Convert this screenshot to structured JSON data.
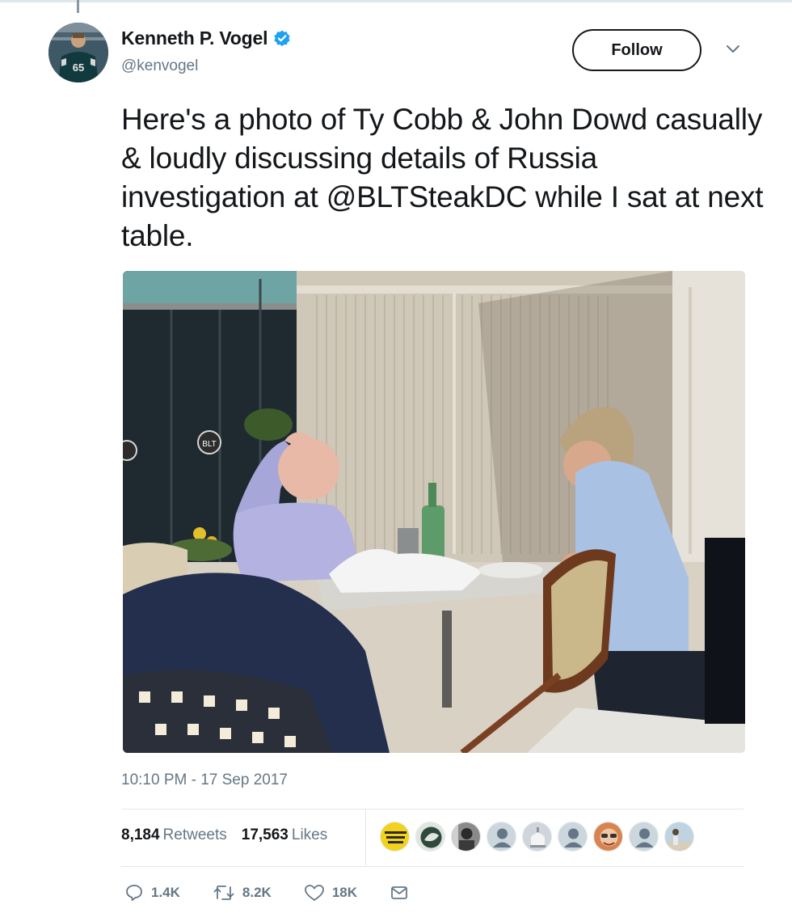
{
  "author": {
    "display_name": "Kenneth P. Vogel",
    "handle": "@kenvogel",
    "verified": true,
    "avatar_jersey_number": "65"
  },
  "follow_button": {
    "label": "Follow"
  },
  "menu": {
    "icon": "chevron-down-icon"
  },
  "tweet": {
    "text": "Here's a photo of Ty Cobb & John Dowd casually & loudly discussing details of Russia investigation at @BLTSteakDC while I sat at next table.",
    "photo": {
      "sign_text": "BLT"
    },
    "timestamp": "10:10 PM - 17 Sep 2017"
  },
  "stats": {
    "retweets": {
      "count": "8,184",
      "label": "Retweets"
    },
    "likes": {
      "count": "17,563",
      "label": "Likes"
    }
  },
  "liker_avatars": [
    {
      "kind": "badge",
      "color": "#f2d21b",
      "text": "DON'T BE SHOCKED"
    },
    {
      "kind": "photo",
      "color": "#3c4a44"
    },
    {
      "kind": "photo",
      "color": "#6b6b6b"
    },
    {
      "kind": "default",
      "color": "#ccd6dd"
    },
    {
      "kind": "photo",
      "color": "#b7bcc2"
    },
    {
      "kind": "default",
      "color": "#ccd6dd"
    },
    {
      "kind": "photo",
      "color": "#d9834e"
    },
    {
      "kind": "default",
      "color": "#ccd6dd"
    },
    {
      "kind": "photo",
      "color": "#bfd3e0"
    }
  ],
  "actions": {
    "reply": {
      "icon": "reply-icon",
      "count": "1.4K"
    },
    "retweet": {
      "icon": "retweet-icon",
      "count": "8.2K"
    },
    "like": {
      "icon": "heart-icon",
      "count": "18K"
    },
    "message": {
      "icon": "envelope-icon"
    }
  },
  "colors": {
    "text": "#14171a",
    "secondary": "#657786",
    "verified_blue": "#1da1f2",
    "divider": "#e1e8ed"
  }
}
